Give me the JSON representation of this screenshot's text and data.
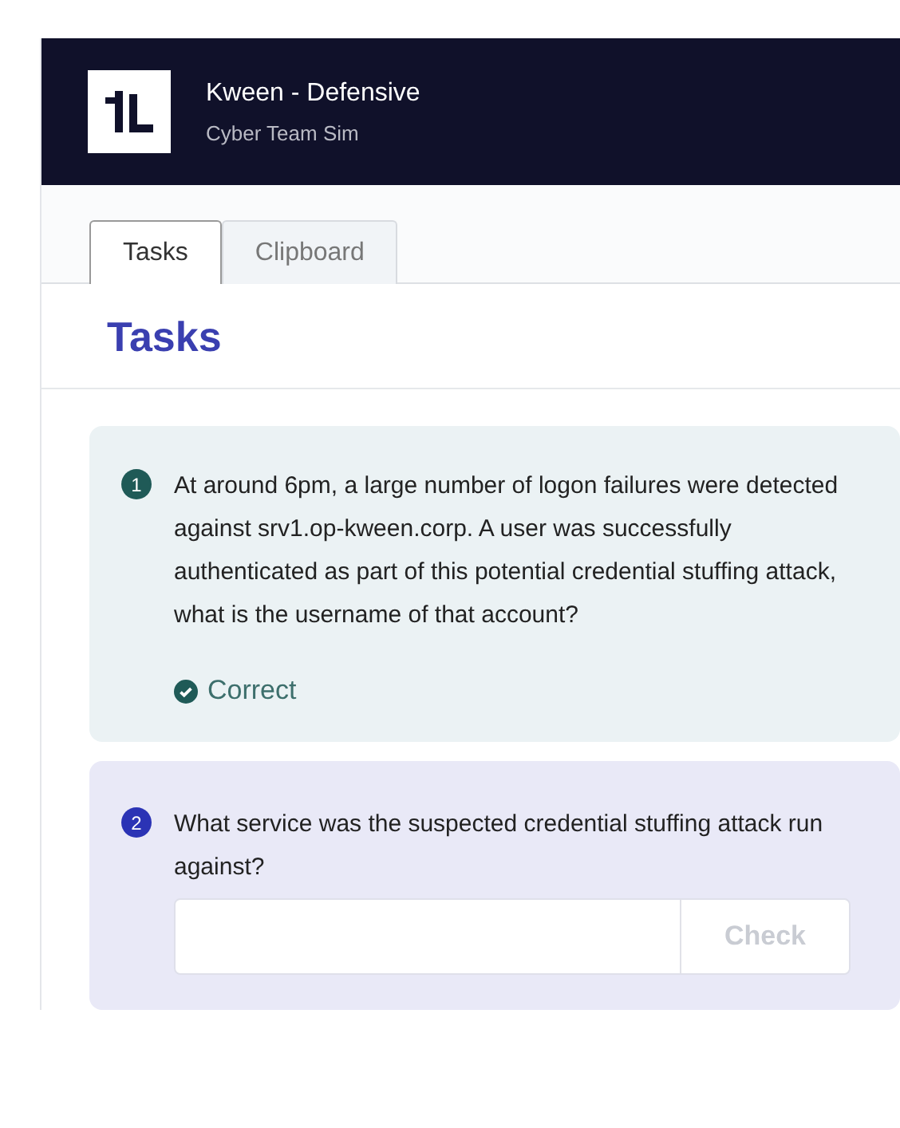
{
  "header": {
    "title": "Kween - Defensive",
    "subtitle": "Cyber Team Sim"
  },
  "tabs": [
    {
      "label": "Tasks",
      "selected": true
    },
    {
      "label": "Clipboard",
      "selected": false
    }
  ],
  "heading": "Tasks",
  "tasks": [
    {
      "kind": "answered",
      "number": "1",
      "color": "#1f5a57",
      "question": "At around 6pm, a large number of logon failures were detected against srv1.op-kween.corp. A user was successfully authenticated as part of this potential credential stuffing attack, what is the username of that account?",
      "status": "Correct"
    },
    {
      "kind": "open",
      "number": "2",
      "color": "#2b33b5",
      "question": "What service was the suspected credential stuffing attack run against?",
      "button": {
        "label": "Check",
        "disabled": true
      }
    }
  ]
}
